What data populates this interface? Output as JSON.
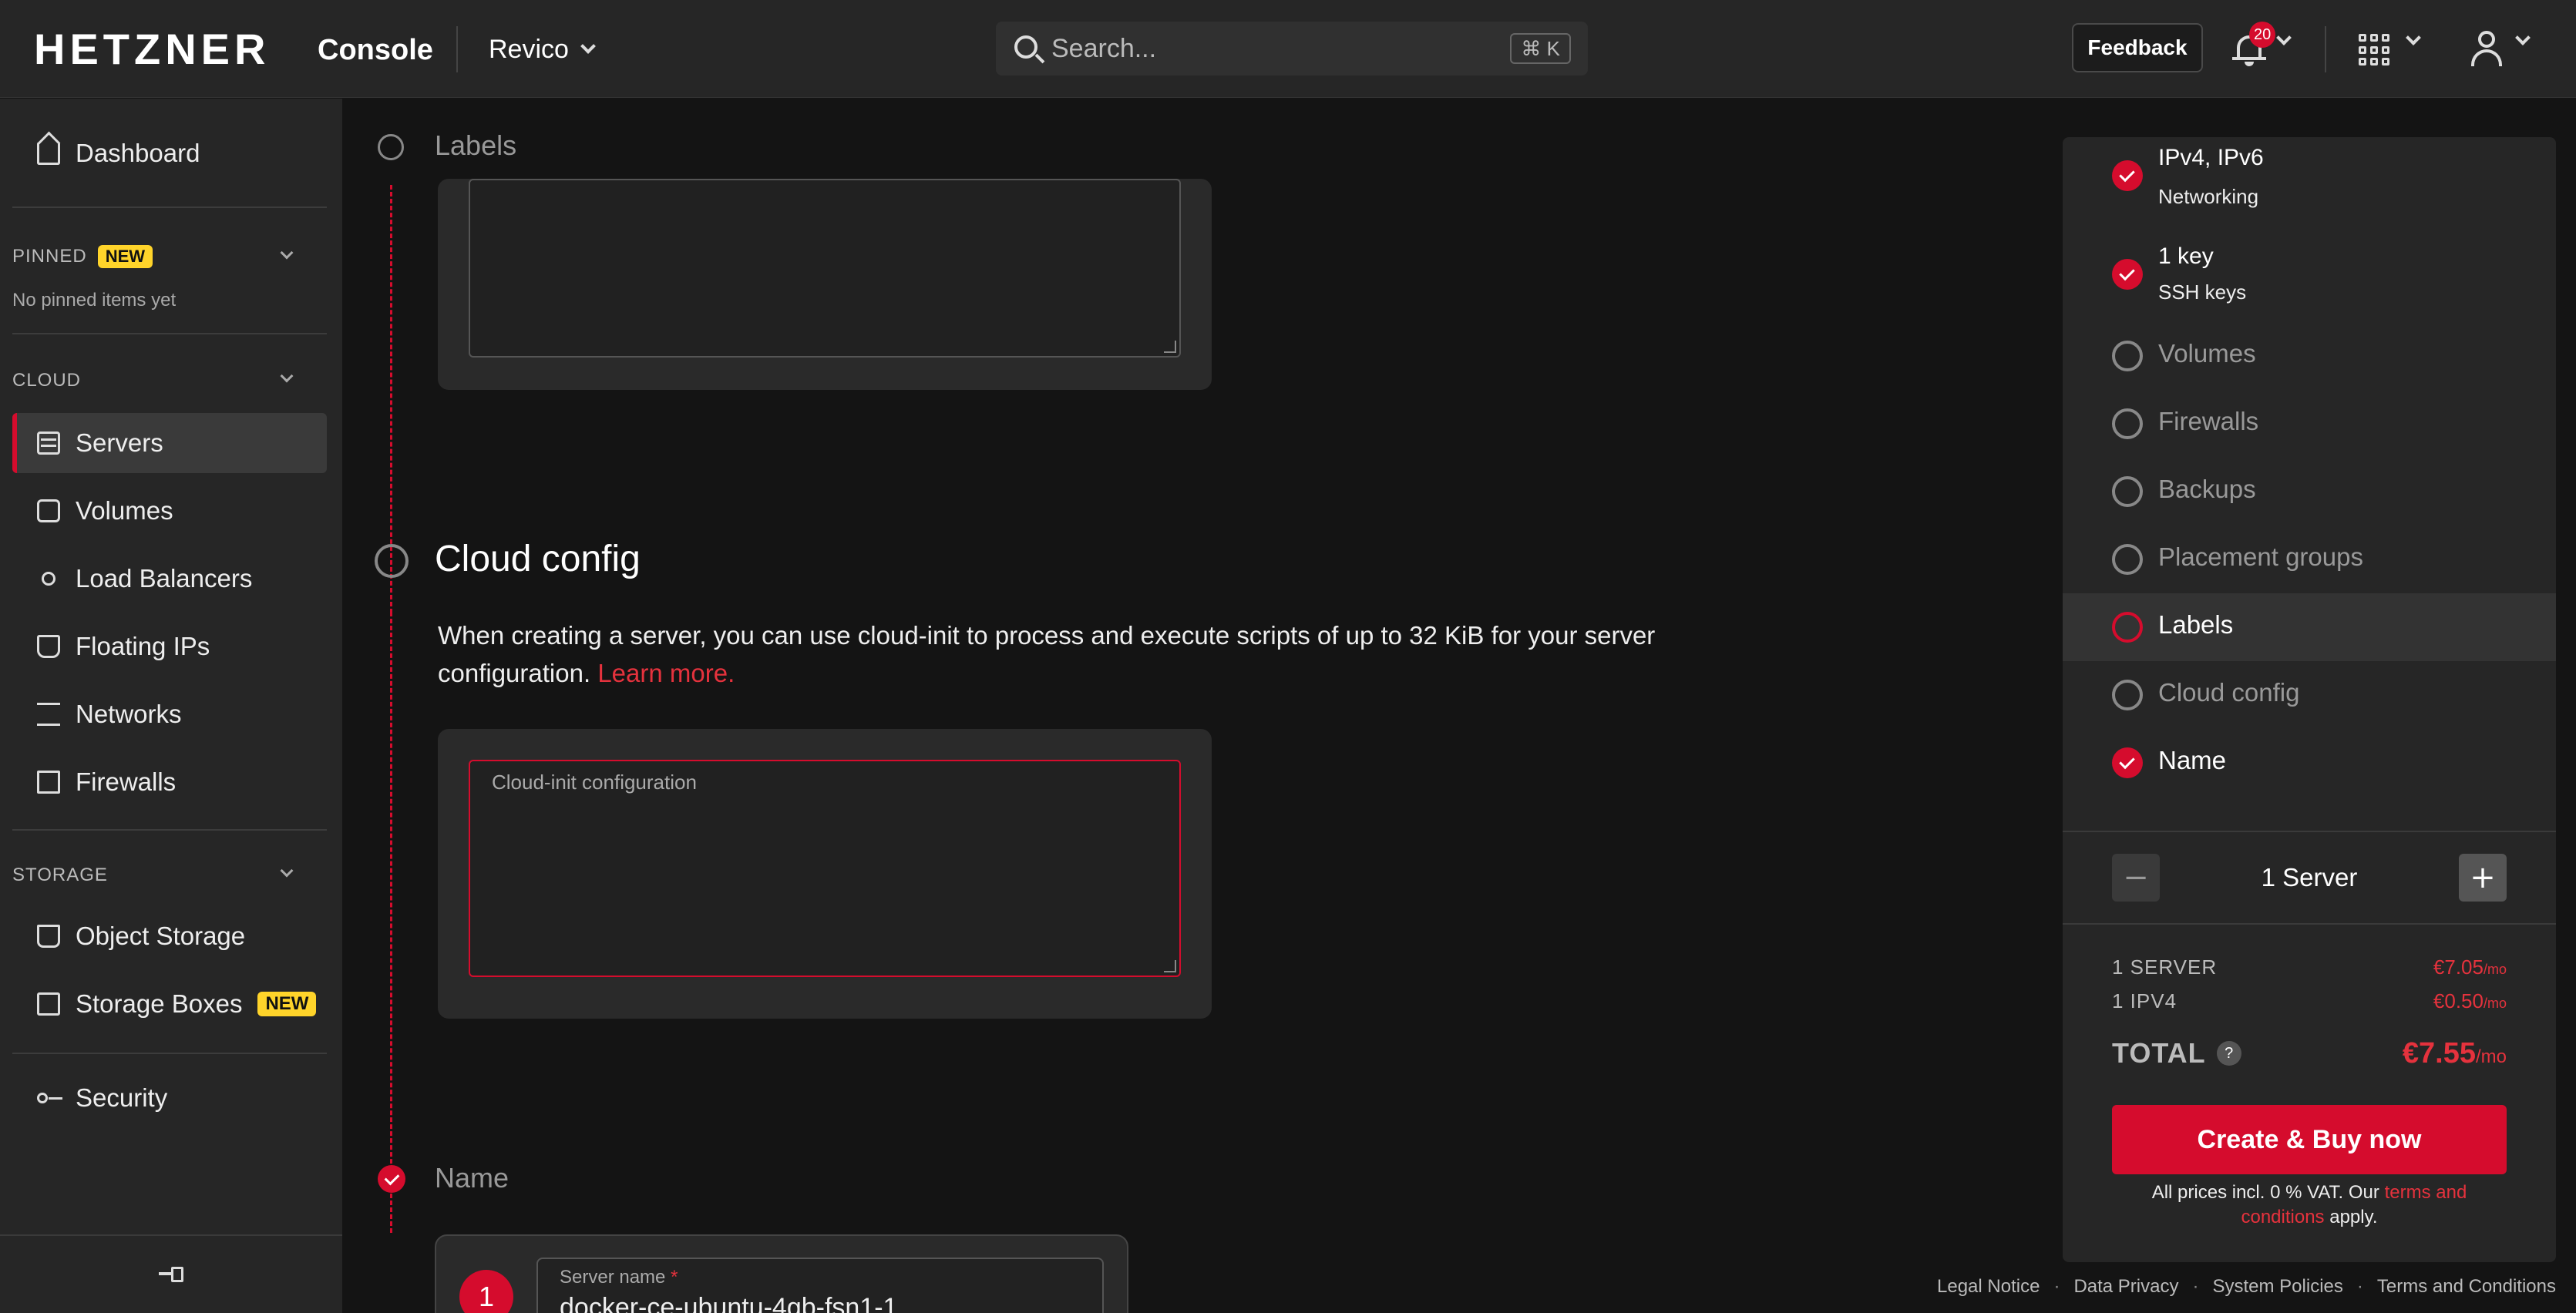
{
  "header": {
    "logo": "HETZNER",
    "logo_sub": "Console",
    "project": "Revico",
    "search_placeholder": "Search...",
    "search_shortcut": "⌘ K",
    "feedback_label": "Feedback",
    "notification_count": "20"
  },
  "sidebar": {
    "dashboard": "Dashboard",
    "pinned_label": "PINNED",
    "pinned_badge": "NEW",
    "pinned_empty": "No pinned items yet",
    "cloud_label": "CLOUD",
    "cloud_items": [
      "Servers",
      "Volumes",
      "Load Balancers",
      "Floating IPs",
      "Networks",
      "Firewalls"
    ],
    "storage_label": "STORAGE",
    "storage_items": [
      "Object Storage",
      "Storage Boxes"
    ],
    "storage_boxes_badge": "NEW",
    "security": "Security"
  },
  "main": {
    "labels_step": "Labels",
    "cloud_config_step": "Cloud config",
    "cloud_config_desc": "When creating a server, you can use cloud-init to process and execute scripts of up to 32 KiB for your server configuration.",
    "learn_more": "Learn more.",
    "cloud_init_placeholder": "Cloud-init configuration",
    "name_step": "Name",
    "server_number": "1",
    "server_name_label": "Server name",
    "server_name_value": "docker-ce-ubuntu-4gb-fsn1-1"
  },
  "summary": {
    "networking_value": "IPv4, IPv6",
    "networking_label": "Networking",
    "ssh_value": "1 key",
    "ssh_label": "SSH keys",
    "items": [
      "Volumes",
      "Firewalls",
      "Backups",
      "Placement groups",
      "Labels",
      "Cloud config",
      "Name"
    ],
    "quantity_label": "1 Server",
    "line1_label": "1 SERVER",
    "line1_price": "€7.05",
    "line2_label": "1 IPV4",
    "line2_price": "€0.50",
    "per_month": "/mo",
    "total_label": "TOTAL",
    "total_price": "€7.55",
    "buy_label": "Create & Buy now",
    "vat_note_prefix": "All prices incl. 0 % VAT. Our",
    "vat_note_link": "terms and conditions",
    "vat_note_suffix": "apply."
  },
  "footer": [
    "Legal Notice",
    "Data Privacy",
    "System Policies",
    "Terms and Conditions"
  ],
  "colors": {
    "accent": "#d50c2d",
    "badge": "#ffd42a",
    "background": "#141414",
    "panel": "#262626"
  }
}
